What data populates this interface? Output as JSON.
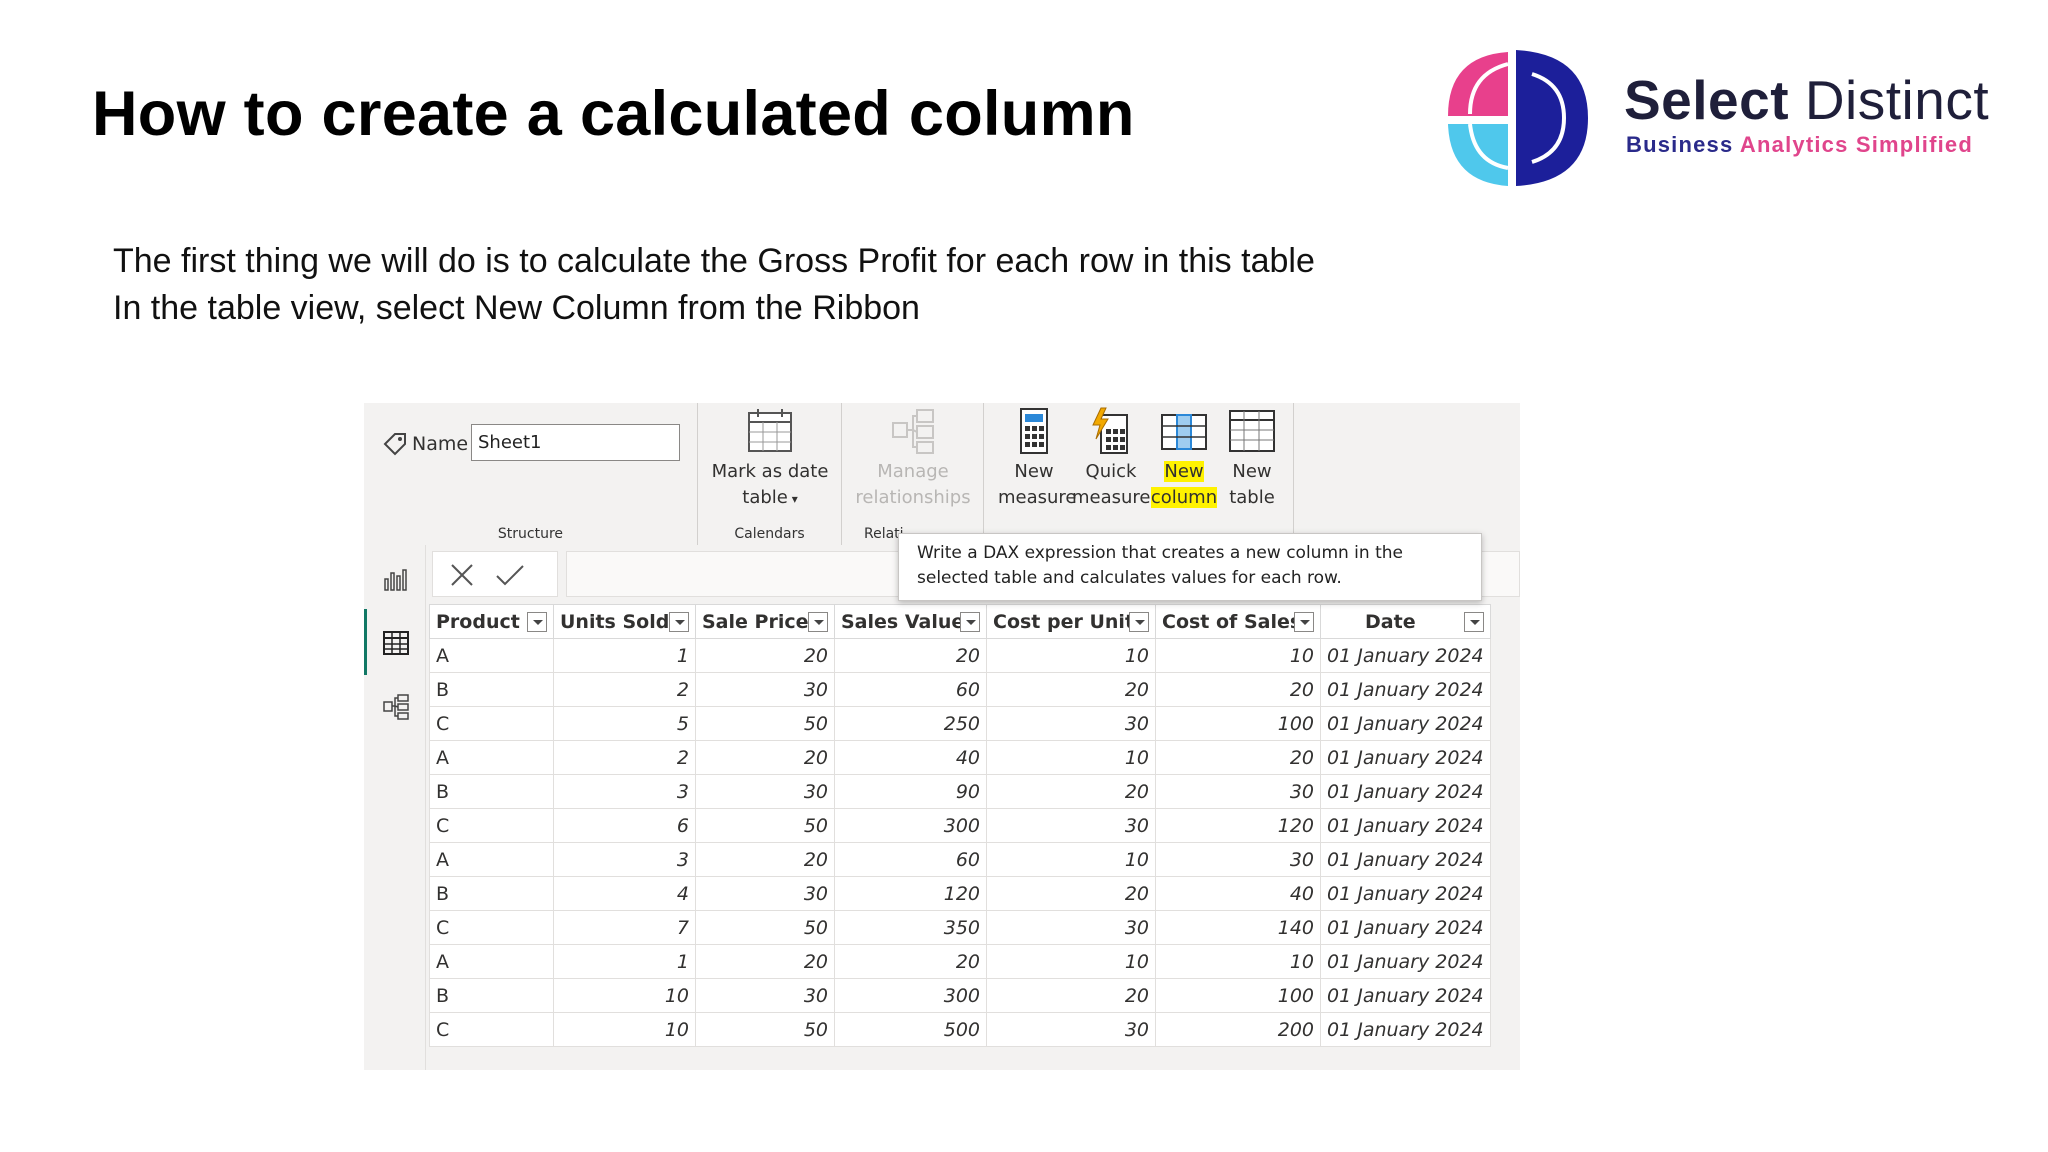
{
  "slide": {
    "title": "How to create a calculated column",
    "lines": [
      "The first thing we will do is to calculate the Gross Profit for each row in this table",
      "In the table view, select New Column from the Ribbon"
    ]
  },
  "logo": {
    "name_bold": "Select",
    "name_light": "Distinct",
    "tagline_part1": "Business",
    "tagline_part2": "Analytics Simplified",
    "colors": {
      "pink": "#e8408c",
      "cyan": "#4fc8ec",
      "navy": "#1c1f9a"
    }
  },
  "ribbon": {
    "name_label": "Name",
    "name_value": "Sheet1",
    "structure_label": "Structure",
    "mark_date_line1": "Mark as date",
    "mark_date_line2": "table",
    "calendars_label": "Calendars",
    "manage_line1": "Manage",
    "manage_line2": "relationships",
    "relationships_label": "Relati",
    "new_measure_line1": "New",
    "new_measure_line2": "measure",
    "quick_measure_line1": "Quick",
    "quick_measure_line2": "measure",
    "new_column_line1": "New",
    "new_column_line2": "column",
    "new_table_line1": "New",
    "new_table_line2": "table",
    "highlight_color": "#fff200"
  },
  "tooltip": {
    "line1": "Write a DAX expression that creates a new column in the",
    "line2": "selected table and calculates values for each row."
  },
  "table": {
    "columns": [
      "Product",
      "Units Sold",
      "Sale Price",
      "Sales Value",
      "Cost per Unit",
      "Cost of Sales",
      "Date"
    ],
    "rows": [
      [
        "A",
        "1",
        "20",
        "20",
        "10",
        "10",
        "01 January 2024"
      ],
      [
        "B",
        "2",
        "30",
        "60",
        "20",
        "20",
        "01 January 2024"
      ],
      [
        "C",
        "5",
        "50",
        "250",
        "30",
        "100",
        "01 January 2024"
      ],
      [
        "A",
        "2",
        "20",
        "40",
        "10",
        "20",
        "01 January 2024"
      ],
      [
        "B",
        "3",
        "30",
        "90",
        "20",
        "30",
        "01 January 2024"
      ],
      [
        "C",
        "6",
        "50",
        "300",
        "30",
        "120",
        "01 January 2024"
      ],
      [
        "A",
        "3",
        "20",
        "60",
        "10",
        "30",
        "01 January 2024"
      ],
      [
        "B",
        "4",
        "30",
        "120",
        "20",
        "40",
        "01 January 2024"
      ],
      [
        "C",
        "7",
        "50",
        "350",
        "30",
        "140",
        "01 January 2024"
      ],
      [
        "A",
        "1",
        "20",
        "20",
        "10",
        "10",
        "01 January 2024"
      ],
      [
        "B",
        "10",
        "30",
        "300",
        "20",
        "100",
        "01 January 2024"
      ],
      [
        "C",
        "10",
        "50",
        "500",
        "30",
        "200",
        "01 January 2024"
      ]
    ]
  }
}
